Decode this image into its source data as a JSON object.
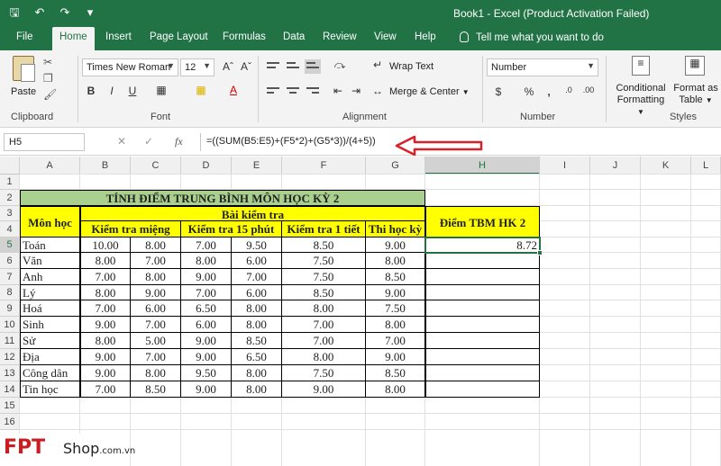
{
  "window": {
    "title": "Book1  -  Excel (Product Activation Failed)"
  },
  "tabs": [
    "File",
    "Home",
    "Insert",
    "Page Layout",
    "Formulas",
    "Data",
    "Review",
    "View",
    "Help"
  ],
  "active_tab": "Home",
  "tell_me": "Tell me what you want to do",
  "ribbon": {
    "paste": "Paste",
    "clipboard": "Clipboard",
    "font_name": "Times New Roman",
    "font_size": "12",
    "font": "Font",
    "wrap_text": "Wrap Text",
    "merge_center": "Merge & Center",
    "alignment": "Alignment",
    "number_format": "Number",
    "number": "Number",
    "conditional_formatting_1": "Conditional",
    "conditional_formatting_2": "Formatting",
    "format_as_table_1": "Format as",
    "format_as_table_2": "Table",
    "styles": "Styles"
  },
  "formula_bar": {
    "name_box": "H5",
    "fx": "fx",
    "formula": "=((SUM(B5:E5)+(F5*2)+(G5*3))/(4+5))"
  },
  "columns": [
    "A",
    "B",
    "C",
    "D",
    "E",
    "F",
    "G",
    "H",
    "I",
    "J",
    "K",
    "L"
  ],
  "rows": [
    "1",
    "2",
    "3",
    "4",
    "5",
    "6",
    "7",
    "8",
    "9",
    "10",
    "11",
    "12",
    "13",
    "14",
    "15",
    "16"
  ],
  "sheet": {
    "title": "TÍNH ĐIỂM TRUNG BÌNH MÔN HỌC KỲ 2",
    "mon_hoc": "Môn học",
    "bai_kiem_tra": "Bài kiểm tra",
    "kt_mieng": "Kiểm tra miệng",
    "kt_15": "Kiểm tra 15 phút",
    "kt_1tiet": "Kiểm tra 1 tiết",
    "thi_hk": "Thi học kỳ",
    "diem_tbm": "Điểm TBM HK 2",
    "subjects": [
      {
        "name": "Toán",
        "b": "10.00",
        "c": "8.00",
        "d": "7.00",
        "e": "9.50",
        "f": "8.50",
        "g": "9.00",
        "h": "8.72"
      },
      {
        "name": "Văn",
        "b": "8.00",
        "c": "7.00",
        "d": "8.00",
        "e": "6.00",
        "f": "7.50",
        "g": "8.00",
        "h": ""
      },
      {
        "name": "Anh",
        "b": "7.00",
        "c": "8.00",
        "d": "9.00",
        "e": "7.00",
        "f": "7.50",
        "g": "8.50",
        "h": ""
      },
      {
        "name": "Lý",
        "b": "8.00",
        "c": "9.00",
        "d": "7.00",
        "e": "6.00",
        "f": "8.50",
        "g": "9.00",
        "h": ""
      },
      {
        "name": "Hoá",
        "b": "7.00",
        "c": "6.00",
        "d": "6.50",
        "e": "8.00",
        "f": "8.00",
        "g": "7.50",
        "h": ""
      },
      {
        "name": "Sinh",
        "b": "9.00",
        "c": "7.00",
        "d": "6.00",
        "e": "8.00",
        "f": "7.00",
        "g": "8.00",
        "h": ""
      },
      {
        "name": "Sử",
        "b": "8.00",
        "c": "5.00",
        "d": "9.00",
        "e": "8.50",
        "f": "7.00",
        "g": "7.00",
        "h": ""
      },
      {
        "name": "Địa",
        "b": "9.00",
        "c": "7.00",
        "d": "9.00",
        "e": "6.50",
        "f": "8.00",
        "g": "9.00",
        "h": ""
      },
      {
        "name": "Công dân",
        "b": "9.00",
        "c": "8.00",
        "d": "9.50",
        "e": "8.00",
        "f": "7.50",
        "g": "8.50",
        "h": ""
      },
      {
        "name": "Tin học",
        "b": "7.00",
        "c": "8.50",
        "d": "9.00",
        "e": "8.00",
        "f": "9.00",
        "g": "8.00",
        "h": ""
      }
    ]
  },
  "logo": {
    "brand": "FPT",
    "shop": "Shop",
    "domain": ".com.vn"
  },
  "colors": {
    "excel_green": "#217346",
    "header_yellow": "#ffff00",
    "title_green": "#a9d08e",
    "arrow_red": "#d92027"
  }
}
